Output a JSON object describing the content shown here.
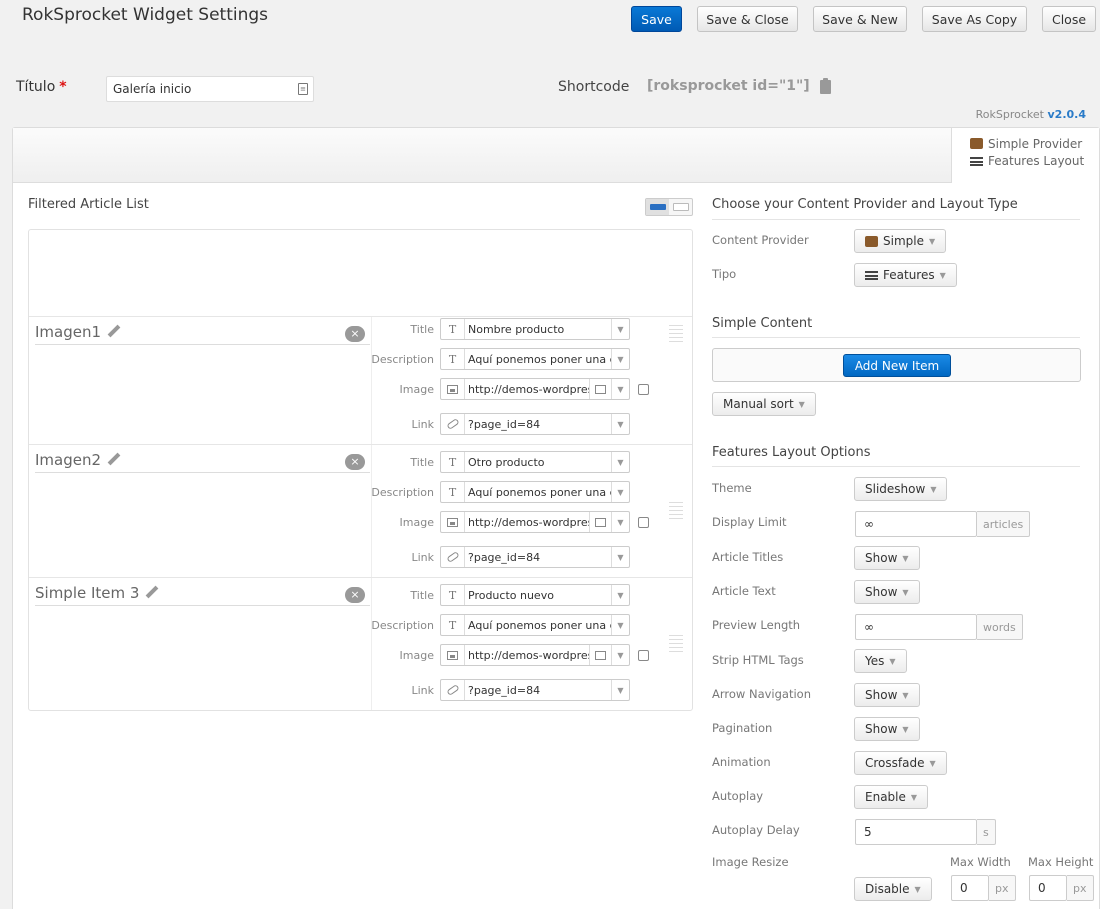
{
  "header": {
    "title": "RokSprocket Widget Settings",
    "buttons": {
      "save": "Save",
      "save_close": "Save & Close",
      "save_new": "Save & New",
      "save_copy": "Save As Copy",
      "close": "Close"
    }
  },
  "form": {
    "titulo_label": "Título",
    "required_mark": "*",
    "titulo_value": "Galería inicio",
    "shortcode_label": "Shortcode",
    "shortcode_value": "[roksprocket id=\"1\"]"
  },
  "version": {
    "prefix": "RokSprocket",
    "number": "v2.0.4"
  },
  "provider_box": {
    "provider": "Simple Provider",
    "layout": "Features Layout"
  },
  "article_list": {
    "title": "Filtered Article List",
    "items": [
      {
        "name": "Imagen1",
        "title": "Nombre producto",
        "description": "Aquí ponemos poner una c",
        "image": "http://demos-wordpres",
        "link": "?page_id=84"
      },
      {
        "name": "Imagen2",
        "title": "Otro producto",
        "description": "Aquí ponemos poner una c",
        "image": "http://demos-wordpres",
        "link": "?page_id=84"
      },
      {
        "name": "Simple Item 3",
        "title": "Producto nuevo",
        "description": "Aquí ponemos poner una c",
        "image": "http://demos-wordpres",
        "link": "?page_id=84"
      }
    ],
    "field_labels": {
      "title": "Title",
      "description": "Description",
      "image": "Image",
      "link": "Link"
    },
    "close_glyph": "×"
  },
  "provider_section": {
    "heading": "Choose your Content Provider and Layout Type",
    "content_provider_label": "Content Provider",
    "content_provider_value": "Simple",
    "tipo_label": "Tipo",
    "tipo_value": "Features"
  },
  "simple_content": {
    "heading": "Simple Content",
    "add_button": "Add New Item",
    "sort_value": "Manual sort"
  },
  "features_options": {
    "heading": "Features Layout Options",
    "theme_label": "Theme",
    "theme_value": "Slideshow",
    "display_limit_label": "Display Limit",
    "display_limit_value": "∞",
    "display_limit_unit": "articles",
    "article_titles_label": "Article Titles",
    "article_titles_value": "Show",
    "article_text_label": "Article Text",
    "article_text_value": "Show",
    "preview_length_label": "Preview Length",
    "preview_length_value": "∞",
    "preview_length_unit": "words",
    "strip_html_label": "Strip HTML Tags",
    "strip_html_value": "Yes",
    "arrow_nav_label": "Arrow Navigation",
    "arrow_nav_value": "Show",
    "pagination_label": "Pagination",
    "pagination_value": "Show",
    "animation_label": "Animation",
    "animation_value": "Crossfade",
    "autoplay_label": "Autoplay",
    "autoplay_value": "Enable",
    "autoplay_delay_label": "Autoplay Delay",
    "autoplay_delay_value": "5",
    "autoplay_delay_unit": "s",
    "image_resize_label": "Image Resize",
    "image_resize_value": "Disable",
    "max_width_label": "Max Width",
    "max_width_value": "0",
    "max_width_unit": "px",
    "max_height_label": "Max Height",
    "max_height_value": "0",
    "max_height_unit": "px"
  },
  "colors": {
    "primary": "#005ab4",
    "required": "#dd1111",
    "version_link": "#2a7bc8"
  }
}
